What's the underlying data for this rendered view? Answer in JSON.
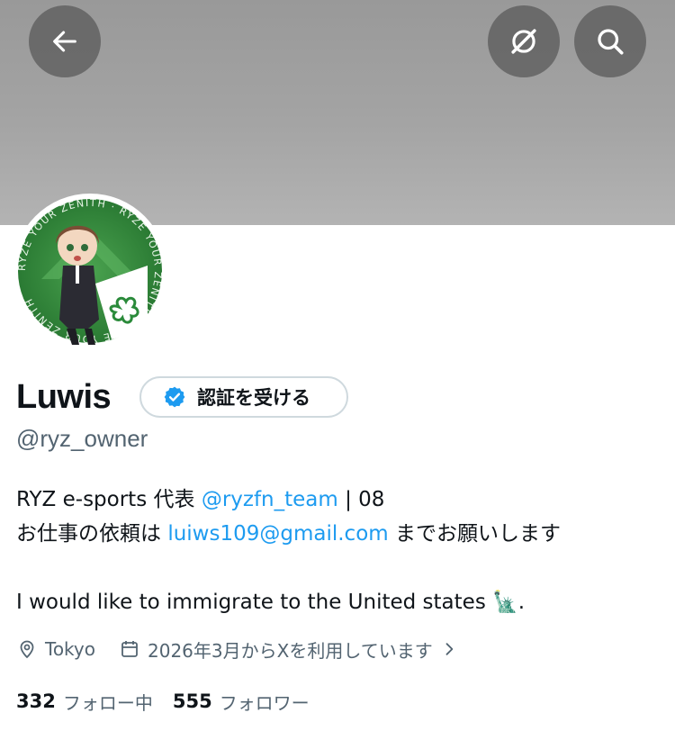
{
  "header": {
    "back_icon": "arrow-left-icon",
    "translate_icon": "translate-off-icon",
    "search_icon": "search-icon",
    "banner_color": "#a4a4a4"
  },
  "profile": {
    "name": "Luwis",
    "verify_label": "認証を受ける",
    "handle": "@ryz_owner",
    "avatar_ring_text": "RYZE YOUR ZENITH · RYZE YOUR ZENITH · RYZE YOUR ZENITH"
  },
  "bio": {
    "line1_pre": "RYZ e-sports 代表 ",
    "line1_link": "@ryzfn_team",
    "line1_post": " | 08",
    "line2_pre": "お仕事の依頼は ",
    "line2_link": "luiws109@gmail.com",
    "line2_post": " までお願いします",
    "line3_text": "I would like to immigrate to the United states ",
    "line3_emoji": "🗽",
    "line3_end": "."
  },
  "meta": {
    "location": "Tokyo",
    "joined": "2026年3月からXを利用しています"
  },
  "stats": {
    "following_count": "332",
    "following_label": "フォロー中",
    "followers_count": "555",
    "followers_label": "フォロワー"
  },
  "colors": {
    "link": "#1d9bf0",
    "secondary_text": "#536471",
    "verified_badge": "#1d9bf0",
    "avatar_green": "#2f8a3a"
  }
}
